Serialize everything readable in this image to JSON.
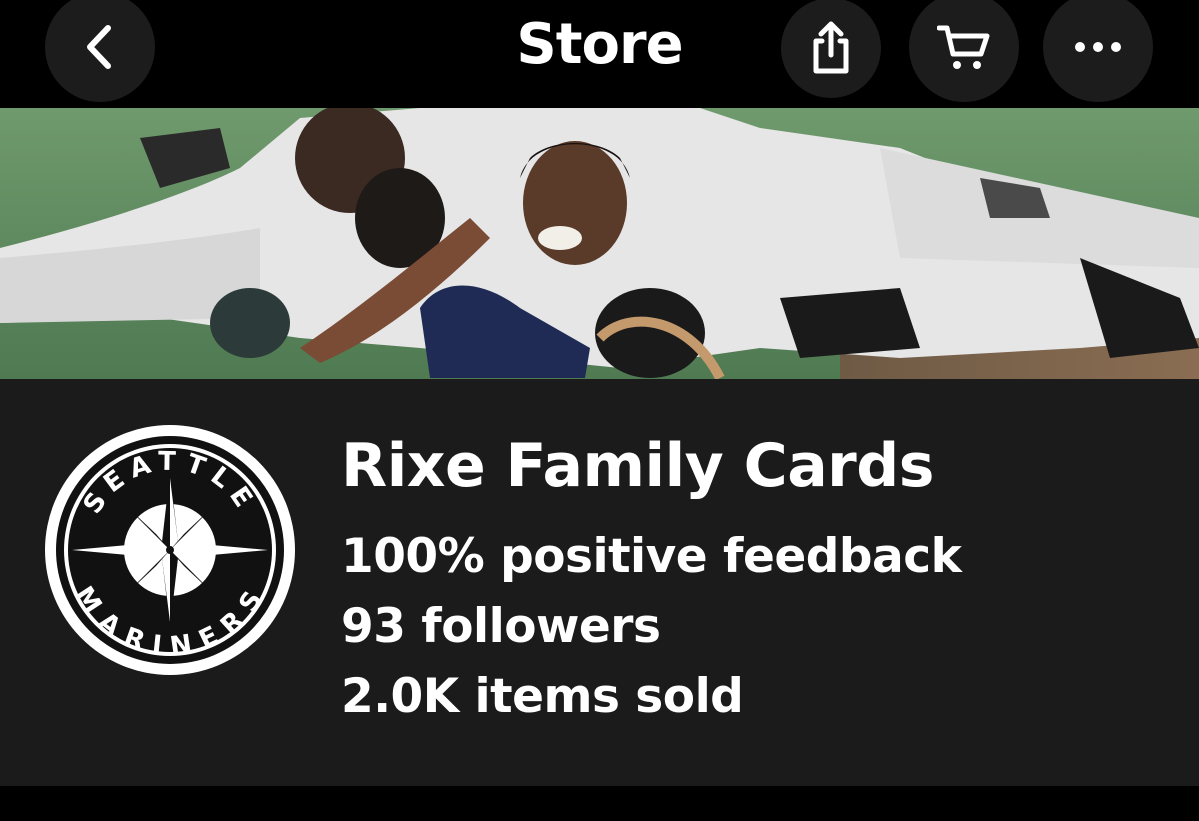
{
  "header": {
    "title": "Store",
    "back_icon": "chevron-left-icon",
    "share_icon": "share-icon",
    "cart_icon": "cart-icon",
    "more_icon": "more-horizontal-icon"
  },
  "banner": {
    "description_icon": "banner-photo"
  },
  "profile": {
    "logo": {
      "top_text": "SEATTLE",
      "bottom_text": "MARINERS"
    },
    "store_name": "Rixe Family Cards",
    "feedback": "100% positive feedback",
    "followers": "93 followers",
    "items_sold": "2.0K items sold"
  },
  "colors": {
    "background": "#000000",
    "panel": "#1b1b1b",
    "button": "#1c1c1c",
    "text": "#ffffff"
  }
}
